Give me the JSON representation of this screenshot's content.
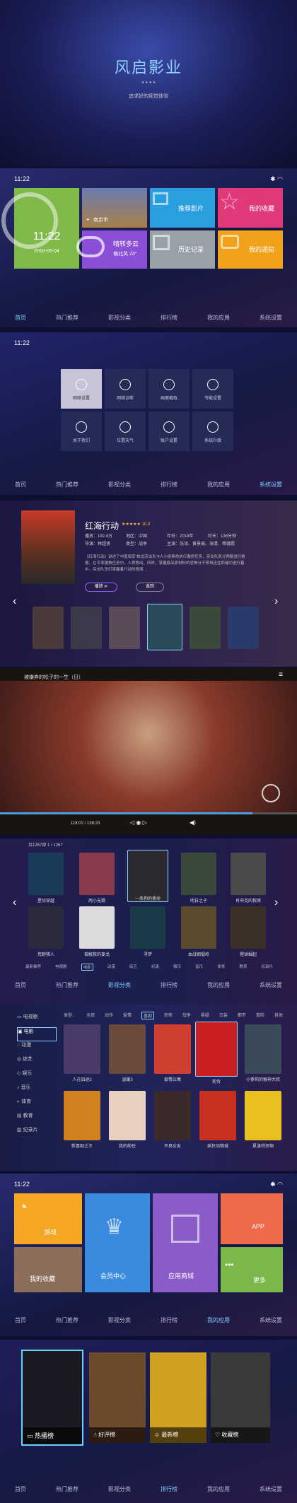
{
  "hero": {
    "title": "风启影业",
    "subtitle": "追求好的视觉体验"
  },
  "status": {
    "time": "11:22",
    "icons": "✱ ◠"
  },
  "nav": [
    "首页",
    "热门推荐",
    "影视分类",
    "排行榜",
    "我的应用",
    "系统设置"
  ],
  "home": {
    "date": "2018-06-04",
    "clock": "11:22",
    "city": "南京市",
    "weather": "晴转多云",
    "wind": "偏北风",
    "temp": "23°",
    "tiles": [
      "推荐影片",
      "我的收藏",
      "历史记录",
      "我的通知"
    ]
  },
  "settings": [
    "网络设置",
    "网络诊断",
    "画面截取",
    "节能设置",
    "关于我们",
    "位置天气",
    "账户设置",
    "系统升级"
  ],
  "detail": {
    "title": "红海行动",
    "rating": "★★★★★ 10.0",
    "meta": [
      "播放：192.4万",
      "地区：中国",
      "年份：2018年",
      "时长：138分钟",
      "导演：林超贤",
      "类型：战争",
      "主演：张译、黄景瑜、海清、蒋璐霞"
    ],
    "desc": "《红海行动》讲述了中国海军“蛟龙突击队”8人小组奉命执行撤侨任务，突击队员分两路进行救援，在平率援救任务中，人质救出，同时，掌握极品原材料的恐怖分子首领还在抓捕中进行着中，突击队员们掌握着行动的极简…",
    "play": "播放",
    "back": "返回"
  },
  "player": {
    "title": "被嫌弃的松子的一生（日）",
    "time": "118:02 / 138:20"
  },
  "list": {
    "count": "共1267部",
    "page": "1 / 1267",
    "row1": [
      "星际穿越",
      "两小无猜",
      "一条狗的使命",
      "明日之子",
      "肖申克的救赎"
    ],
    "row2": [
      "荒野猎人",
      "被解救的姜戈",
      "寻梦",
      "血战钢锯岭",
      "猩球崛起"
    ],
    "cats": [
      "最新推荐",
      "电视剧",
      "电影",
      "动漫",
      "综艺",
      "纪录",
      "娱乐",
      "音乐",
      "体育",
      "教育",
      "纪录片"
    ]
  },
  "browse": {
    "side": [
      "电视剧",
      "电影",
      "动漫",
      "综艺",
      "娱乐",
      "音乐",
      "体育",
      "教育",
      "纪录片"
    ],
    "types": [
      "类型：",
      "全部",
      "动作",
      "爱情",
      "喜剧",
      "恐怖",
      "战争",
      "悬疑",
      "古装",
      "都市",
      "冒险",
      "其他"
    ],
    "row1": [
      "人在囧途2",
      "温暖3",
      "爱情公寓",
      "死侍",
      "小萝莉的猴神大叔"
    ],
    "row2": [
      "新喜剧之王",
      "我的前任",
      "不良女友",
      "疯狂动物城",
      "夏洛特烦恼"
    ]
  },
  "apps": {
    "tiles": [
      "游戏",
      "我的收藏",
      "会员中心",
      "应用商城",
      "APP",
      "更多"
    ]
  },
  "rank": {
    "tiles": [
      "热播榜",
      "好评榜",
      "最新榜",
      "收藏榜"
    ]
  }
}
